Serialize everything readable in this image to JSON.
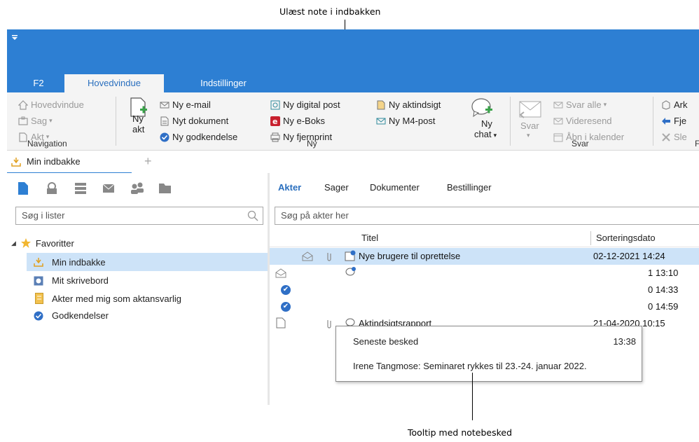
{
  "callouts": {
    "top": "Ulæst note i indbakken",
    "bottom": "Tooltip med notebesked"
  },
  "ribbon_tabs": [
    "F2",
    "Hovedvindue",
    "Indstillinger"
  ],
  "ribbon": {
    "navigation": {
      "items": [
        "Hovedvindue",
        "Sag",
        "Akt"
      ],
      "group": "Navigation"
    },
    "ny": {
      "ny_akt": [
        "Ny",
        "akt"
      ],
      "col1": [
        "Ny e-mail",
        "Nyt dokument",
        "Ny godkendelse"
      ],
      "col2": [
        "Ny digital post",
        "Ny e-Boks",
        "Ny fjernprint"
      ],
      "col3": [
        "Ny aktindsigt",
        "Ny M4-post"
      ],
      "ny_chat": [
        "Ny",
        "chat"
      ],
      "group": "Ny"
    },
    "svar": {
      "svar": "Svar",
      "items": [
        "Svar alle",
        "Videresend",
        "Åbn i kalender"
      ],
      "group": "Svar"
    },
    "clipped": {
      "items": [
        "Ark",
        "Fje",
        "Sle"
      ],
      "group": "F"
    }
  },
  "doc_tab": {
    "label": "Min indbakke",
    "add": "+"
  },
  "left_pane": {
    "search_placeholder": "Søg i lister",
    "favorites_label": "Favoritter",
    "tree": [
      "Min indbakke",
      "Mit skrivebord",
      "Akter med mig som aktansvarlig",
      "Godkendelser"
    ]
  },
  "right_pane": {
    "tabs": [
      "Akter",
      "Sager",
      "Dokumenter",
      "Bestillinger"
    ],
    "search_placeholder": "Søg på akter her",
    "columns": {
      "title": "Titel",
      "date": "Sorteringsdato"
    },
    "rows": [
      {
        "title": "Nye brugere til oprettelse",
        "date": "02-12-2021 14:24"
      },
      {
        "title": "",
        "date": "1 13:10"
      },
      {
        "title": "",
        "date": "0 14:33"
      },
      {
        "title": "",
        "date": "0 14:59"
      },
      {
        "title": "Aktindsigtsrapport",
        "date": "21-04-2020 10:15"
      }
    ]
  },
  "tooltip": {
    "header": "Seneste besked",
    "time": "13:38",
    "message": "Irene Tangmose: Seminaret rykkes til 23.-24. januar 2022."
  },
  "colors": {
    "accent": "#2d7fd3",
    "selection": "#cde3f8",
    "ribbon_bg": "#f4f4f4"
  }
}
